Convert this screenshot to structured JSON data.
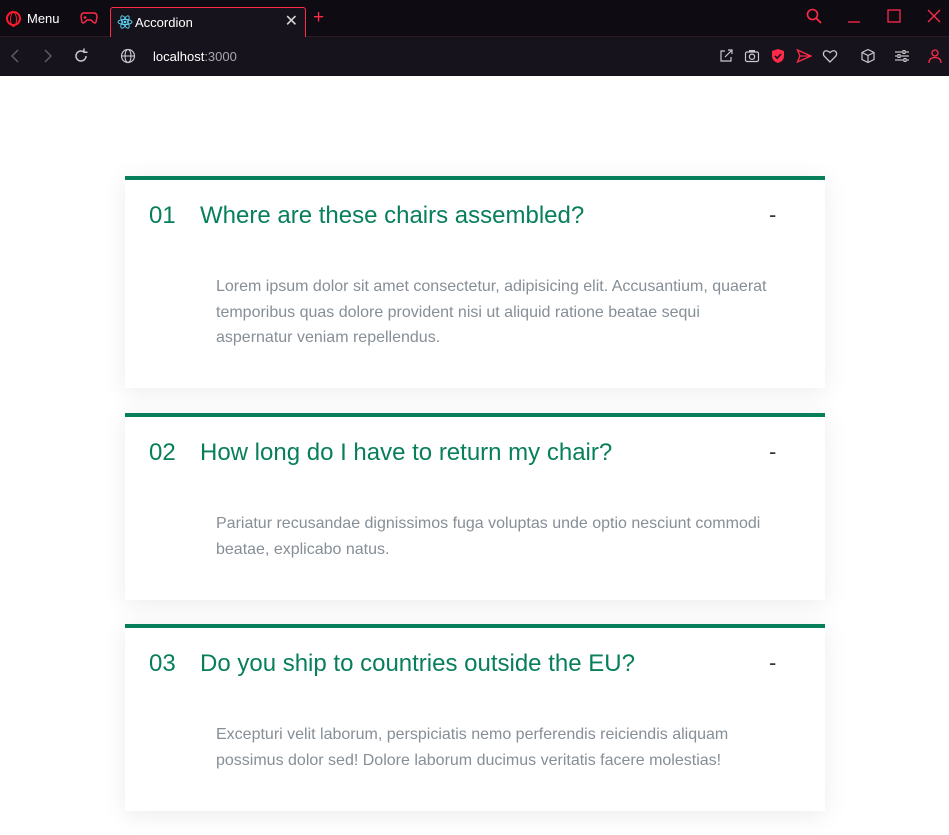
{
  "browser": {
    "menu_label": "Menu",
    "tab_title": "Accordion",
    "tab_close": "✕",
    "new_tab": "+",
    "url_host": "localhost",
    "url_port": ":3000",
    "accent_color": "#ff2a4a"
  },
  "accordion": {
    "accent_color": "#087f5b",
    "items": [
      {
        "number": "01",
        "title": "Where are these chairs assembled?",
        "toggle": "-",
        "text": "Lorem ipsum dolor sit amet consectetur, adipisicing elit. Accusantium, quaerat temporibus quas dolore provident nisi ut aliquid ratione beatae sequi aspernatur veniam repellendus."
      },
      {
        "number": "02",
        "title": "How long do I have to return my chair?",
        "toggle": "-",
        "text": "Pariatur recusandae dignissimos fuga voluptas unde optio nesciunt commodi beatae, explicabo natus."
      },
      {
        "number": "03",
        "title": "Do you ship to countries outside the EU?",
        "toggle": "-",
        "text": "Excepturi velit laborum, perspiciatis nemo perferendis reiciendis aliquam possimus dolor sed! Dolore laborum ducimus veritatis facere molestias!"
      }
    ]
  }
}
